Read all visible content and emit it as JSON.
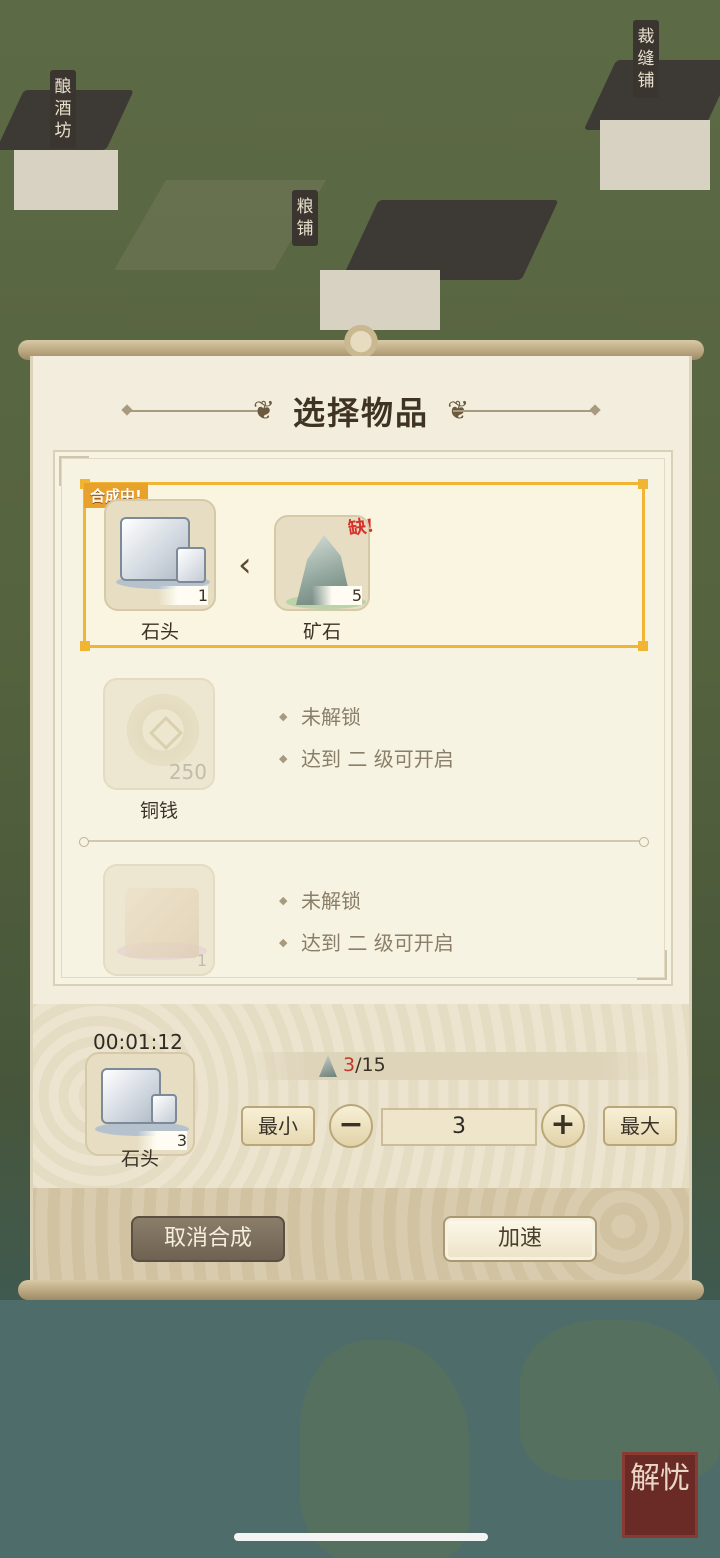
{
  "background": {
    "signs": [
      "酿酒坊",
      "粮铺",
      "裁缝铺"
    ],
    "seal_text": "解忧"
  },
  "dialog": {
    "title": "选择物品",
    "recipes": [
      {
        "status_badge": "合成中!",
        "output": {
          "name": "石头",
          "count": "1",
          "icon": "stone-block-icon"
        },
        "input": {
          "name": "矿石",
          "count": "5",
          "icon": "ore-icon",
          "missing_tag": "缺!"
        },
        "arrow": "‹"
      },
      {
        "output": {
          "name": "铜钱",
          "count": "250",
          "icon": "coin-icon"
        },
        "locked_text": "未解锁",
        "unlock_hint": "达到 二 级可开启"
      },
      {
        "output": {
          "name": "",
          "count": "1",
          "icon": "tofu-icon"
        },
        "locked_text": "未解锁",
        "unlock_hint": "达到 二 级可开启"
      }
    ],
    "crafting": {
      "timer": "00:01:12",
      "output_name": "石头",
      "output_count": "3",
      "material_current": "3",
      "material_total": "/15",
      "min_label": "最小",
      "max_label": "最大",
      "minus": "−",
      "plus": "+",
      "quantity": "3"
    },
    "buttons": {
      "cancel": "取消合成",
      "speed_up": "加速"
    }
  },
  "colors": {
    "selected_border": "#f0b532",
    "missing": "#d8302a",
    "panel_bg": "#f2eddc"
  }
}
